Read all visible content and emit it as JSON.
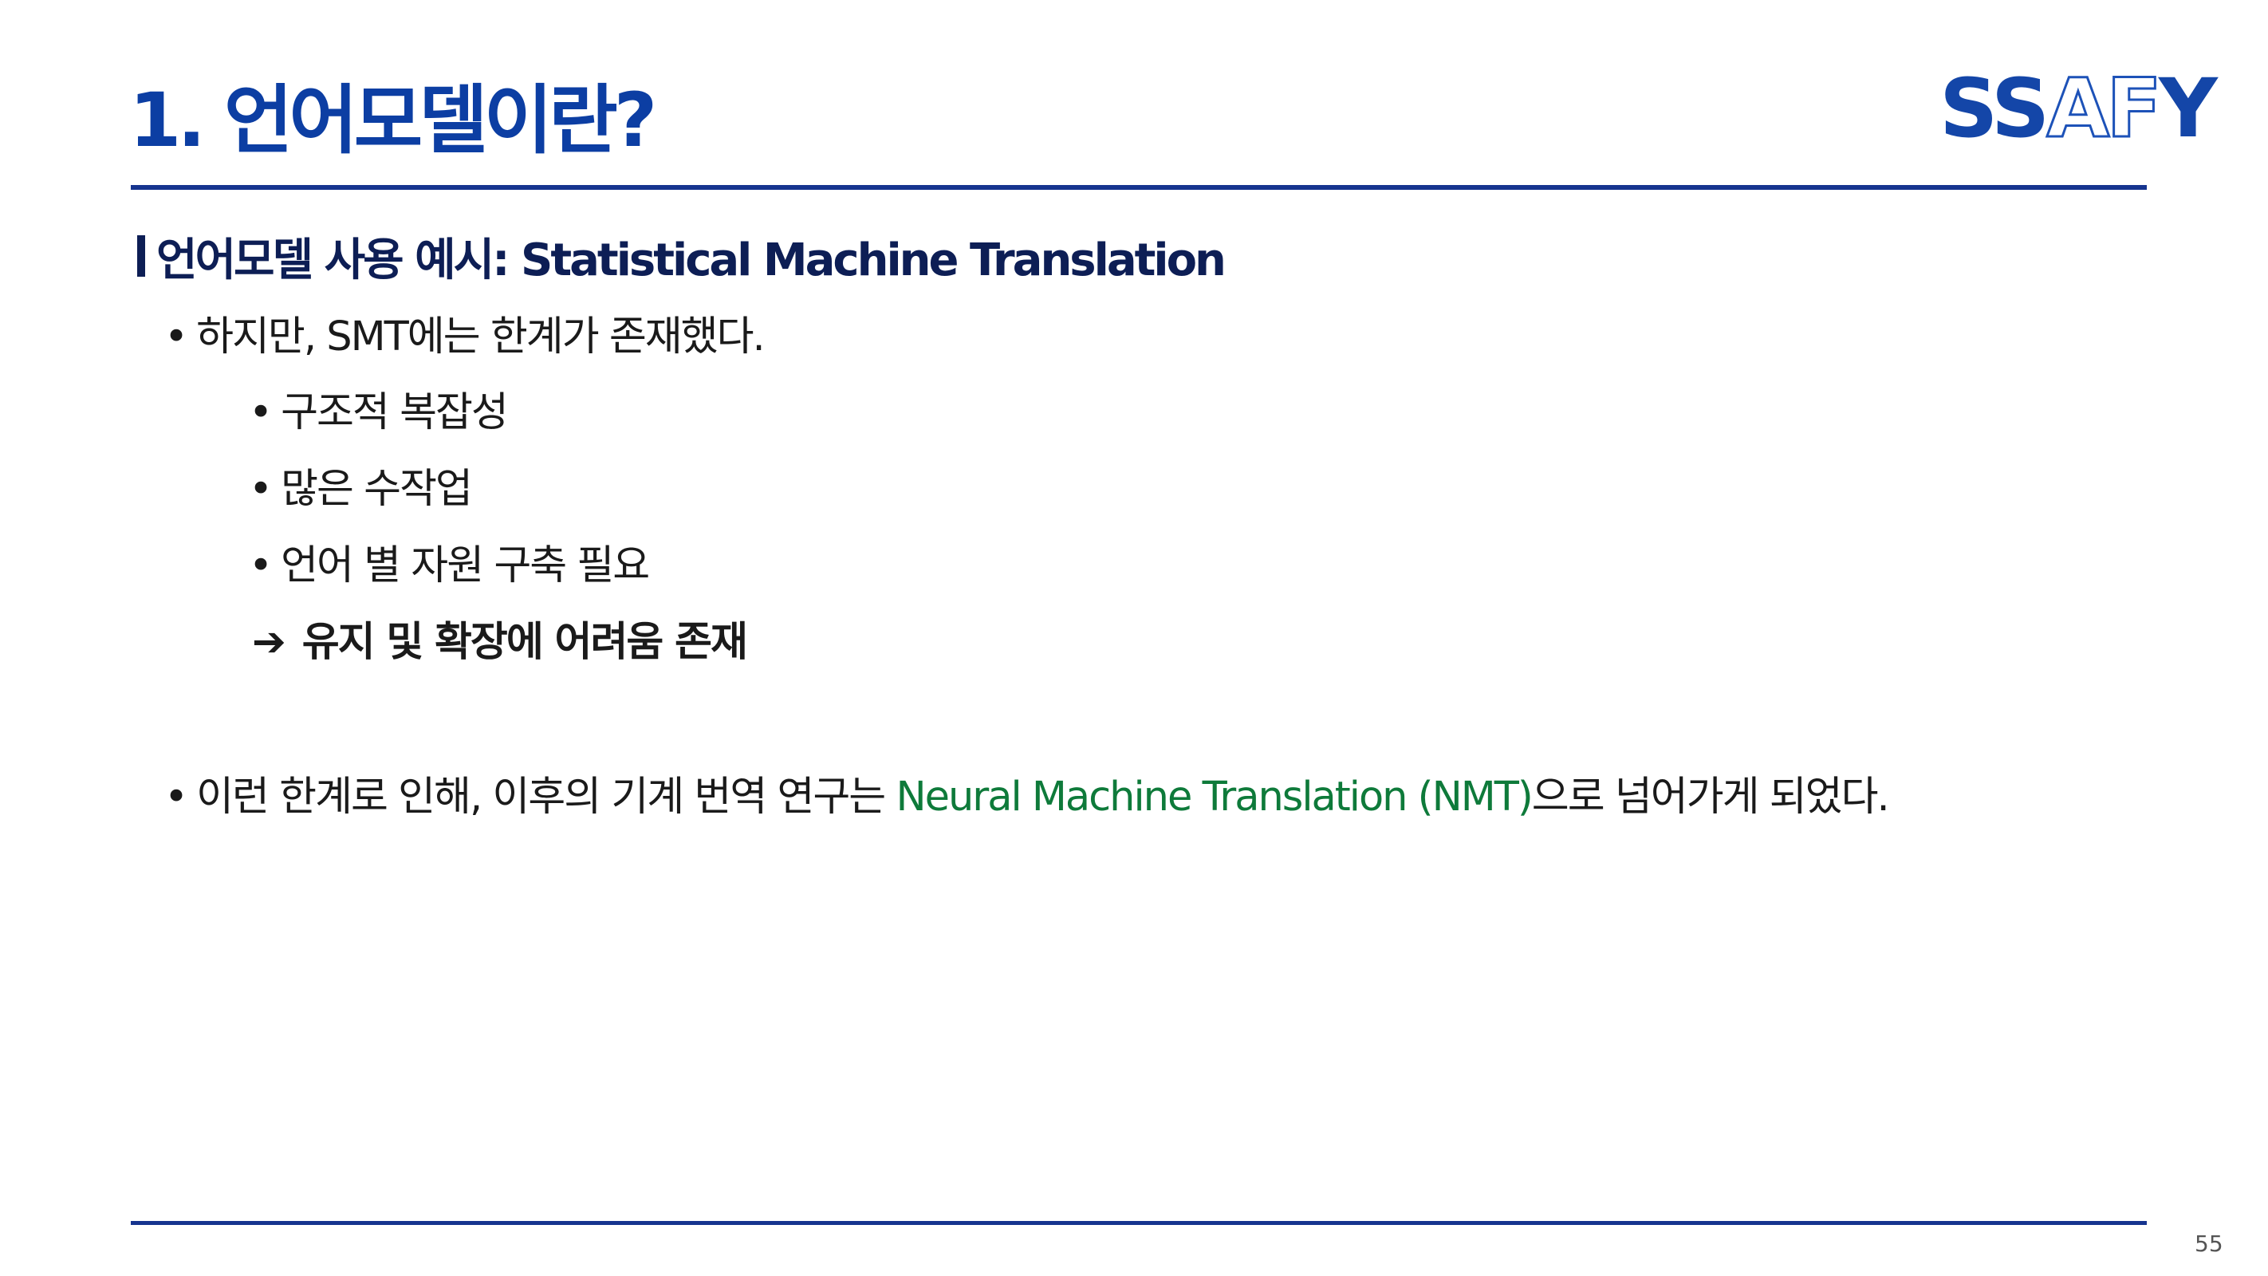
{
  "title": "1. 언어모델이란?",
  "logo": {
    "part1": "SS",
    "part2": "AF",
    "part3": "Y"
  },
  "section_heading": "언어모델 사용 예시: Statistical Machine Translation",
  "bullets": {
    "symbol": "•",
    "arrow": "➔",
    "l1": "하지만, SMT에는 한계가 존재했다.",
    "l2": "구조적 복잡성",
    "l3": "많은 수작업",
    "l4": "언어 별 자원 구축 필요",
    "l5": "유지 및 확장에 어려움 존재",
    "l6_pre": "이런 한계로 인해, 이후의 기계 번역 연구는 ",
    "l6_highlight": "Neural Machine Translation (NMT)",
    "l6_post": "으로 넘어가게 되었다."
  },
  "page_number": "55",
  "colors": {
    "title": "#0c3ea3",
    "heading": "#0d1e55",
    "rule": "#16348f",
    "highlight": "#0e7a3a"
  }
}
